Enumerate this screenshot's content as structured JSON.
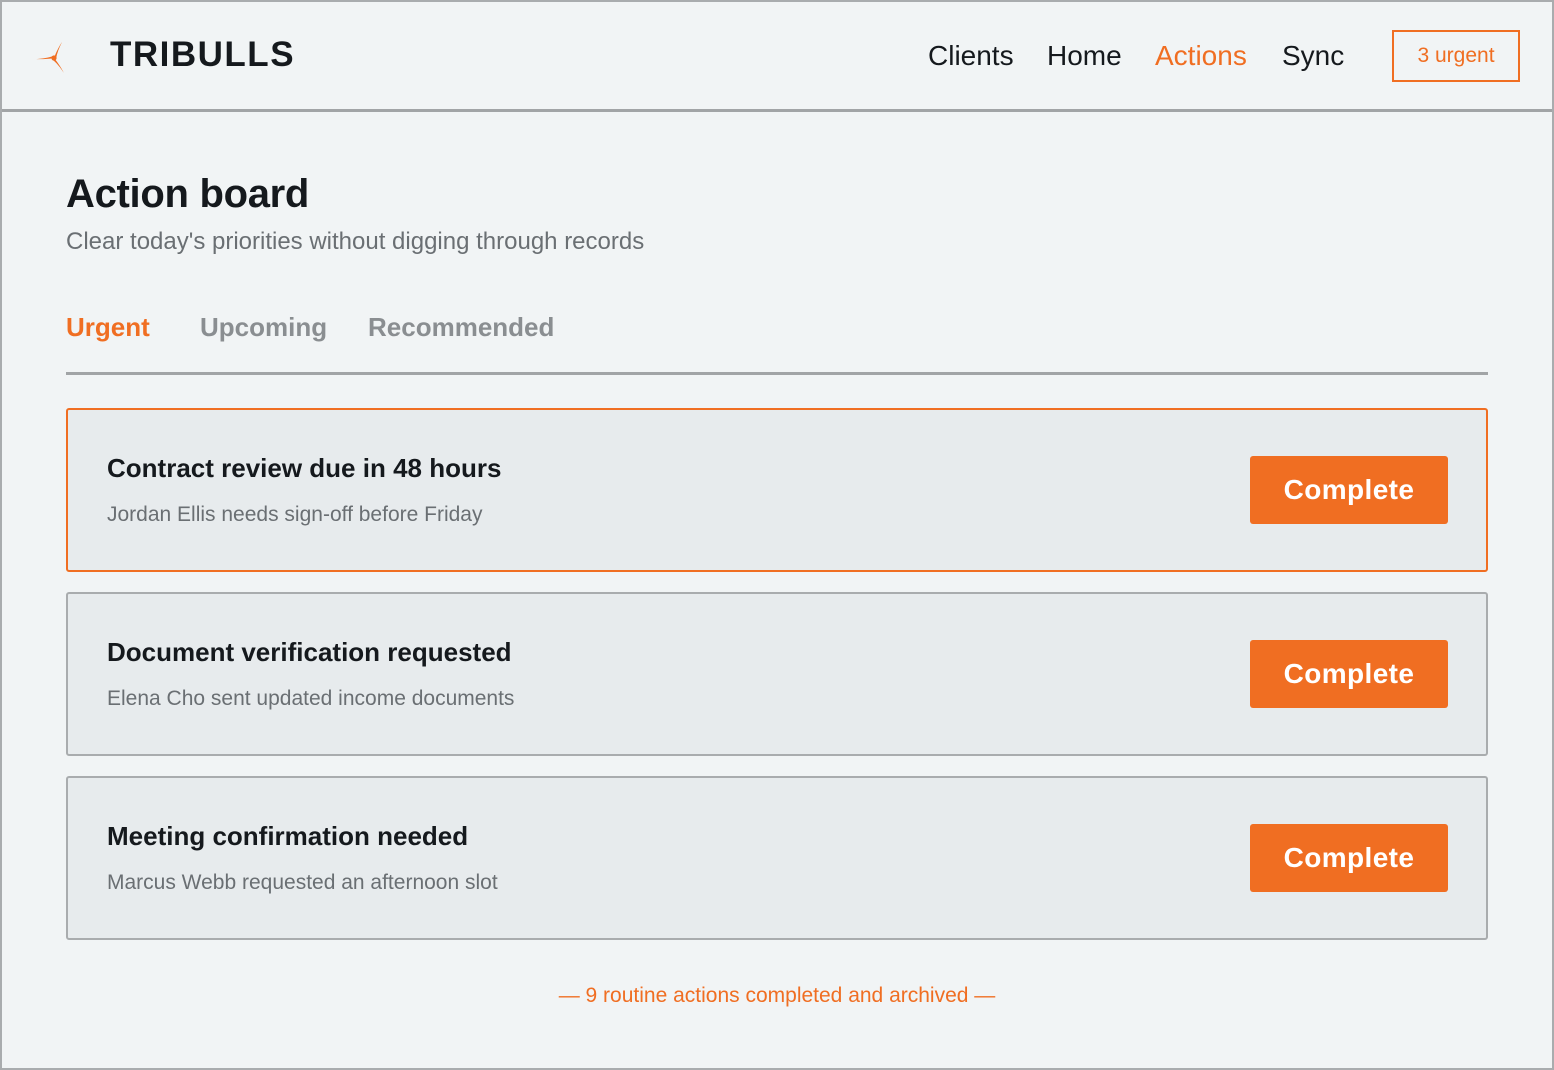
{
  "brand": {
    "name": "TRIBULLS",
    "logo_icon": "tri-blade-logo-icon",
    "accent_color": "#f06e22"
  },
  "nav": {
    "items": [
      {
        "label": "Clients",
        "active": false
      },
      {
        "label": "Home",
        "active": false
      },
      {
        "label": "Actions",
        "active": true
      },
      {
        "label": "Sync",
        "active": false
      }
    ],
    "urgent_badge": "3 urgent"
  },
  "page": {
    "title": "Action board",
    "subtitle": "Clear today's priorities without digging through records"
  },
  "tabs": [
    {
      "label": "Urgent",
      "active": true
    },
    {
      "label": "Upcoming",
      "active": false
    },
    {
      "label": "Recommended",
      "active": false
    }
  ],
  "actions": [
    {
      "title": "Contract review due in 48 hours",
      "description": "Jordan Ellis needs sign-off before Friday",
      "button_label": "Complete",
      "highlighted": true
    },
    {
      "title": "Document verification requested",
      "description": "Elena Cho sent updated income documents",
      "button_label": "Complete",
      "highlighted": false
    },
    {
      "title": "Meeting confirmation needed",
      "description": "Marcus Webb requested an afternoon slot",
      "button_label": "Complete",
      "highlighted": false
    }
  ],
  "footer": {
    "archived_note": "— 9 routine actions completed and archived —"
  }
}
